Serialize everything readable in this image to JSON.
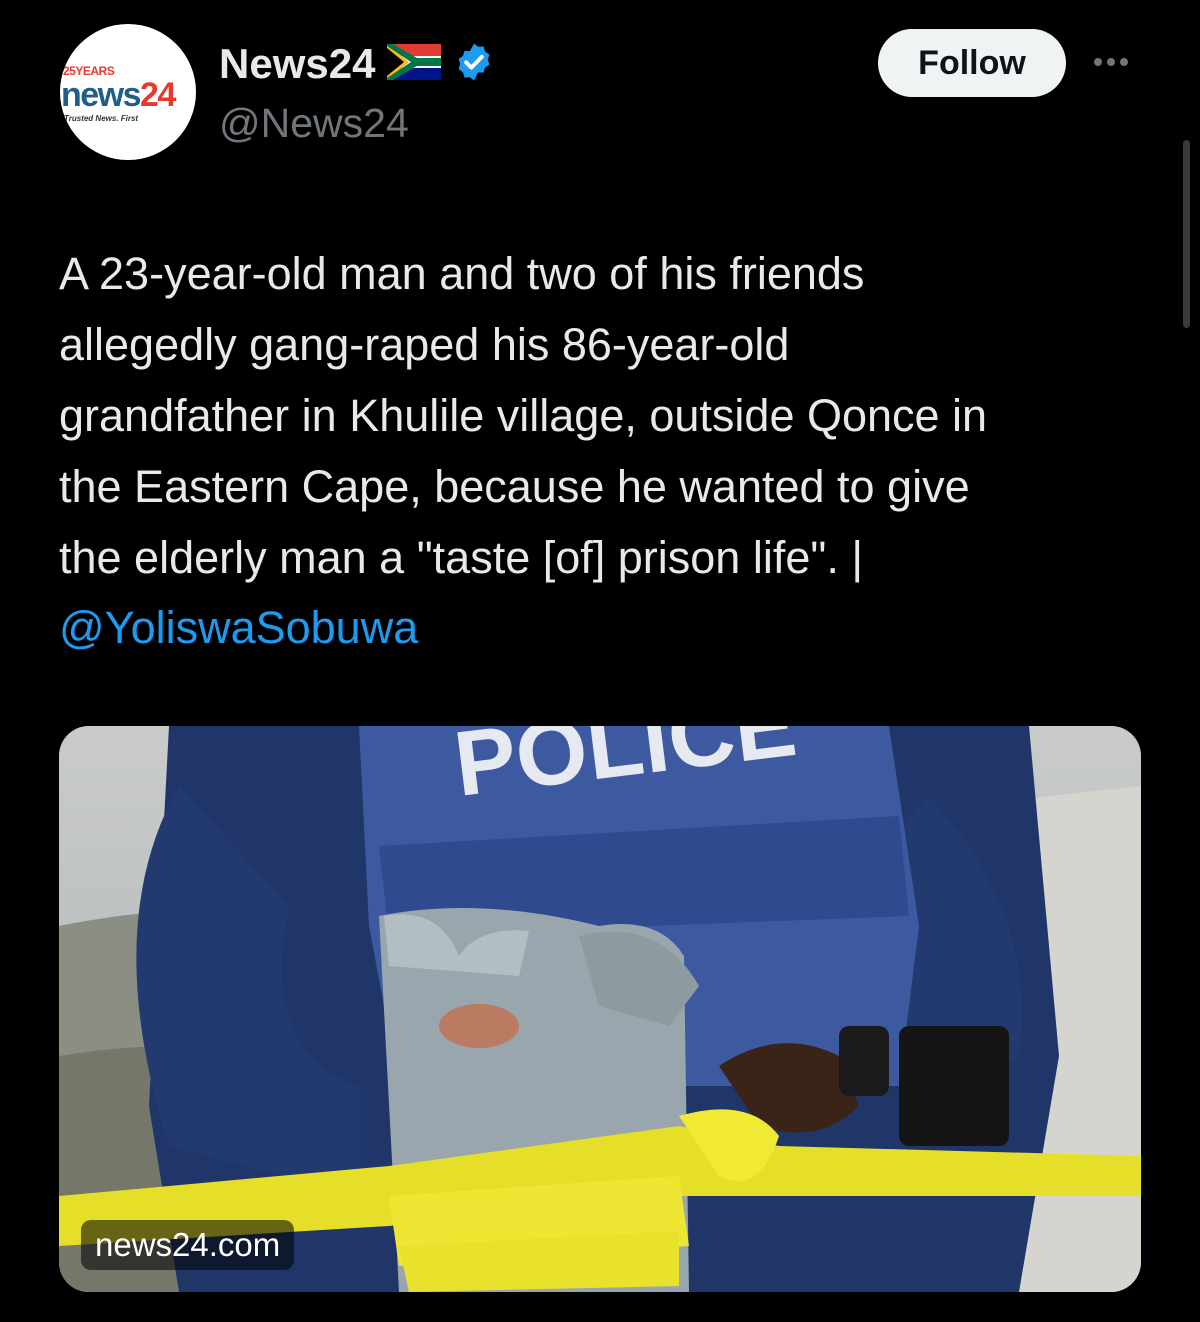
{
  "account": {
    "avatar_years": "25YEARS",
    "avatar_brand_main": "news",
    "avatar_brand_num": "24",
    "avatar_tagline": "Trusted News. First",
    "display_name": "News24",
    "handle": "@News24",
    "flag_icon": "south-africa-flag-icon",
    "verified_icon": "verified-badge-icon",
    "verified_color": "#1d9bf0"
  },
  "actions": {
    "follow_label": "Follow",
    "more_icon": "more-options-icon"
  },
  "post": {
    "text": "A 23-year-old man and two of his friends\nallegedly gang-raped his 86-year-old\ngrandfather in Khulile village, outside Qonce in\nthe Eastern Cape, because he wanted to give\nthe elderly man a \"taste [of] prison life\". |",
    "mention": "@YoliswaSobuwa",
    "link_color": "#1d9bf0"
  },
  "media": {
    "vest_text": "POLICE",
    "domain": "news24.com"
  }
}
